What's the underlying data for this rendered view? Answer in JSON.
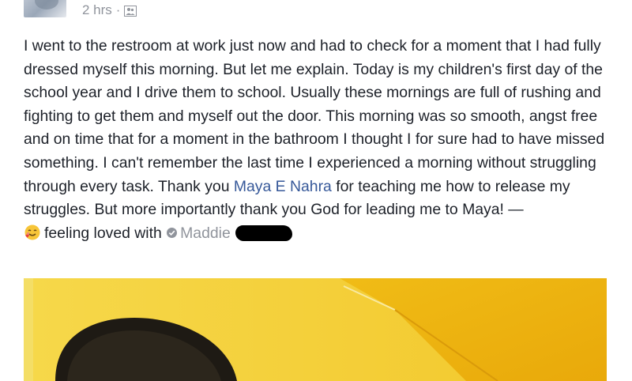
{
  "header": {
    "timestamp": "2 hrs",
    "separator": "·",
    "audience_icon": "friends-icon"
  },
  "post": {
    "text_before_mention": "I went to the restroom at work just now and had to check for a moment that I had fully dressed myself this morning. But let me explain. Today is my children's first day of the school year and I drive them to school. Usually these mornings are full of rushing and fighting to get them and myself out the door. This morning was so smooth, angst free and on time that for a moment in the bathroom I thought I for sure had to have missed something. I can't remember the last time I experienced a morning without struggling through every task. Thank you ",
    "mention": "Maya E Nahra",
    "text_after_mention": " for teaching me how to release my struggles. But more importantly thank you God for leading me to Maya! —",
    "feeling_icon": "loved-emoji-icon",
    "feeling_text": "feeling loved with",
    "tagged_icon": "verified-check-icon",
    "tagged_name": "Maddie"
  },
  "colors": {
    "link": "#365899",
    "meta": "#90949c",
    "text": "#1d2129",
    "photo_yellow": "#f1c51d"
  }
}
